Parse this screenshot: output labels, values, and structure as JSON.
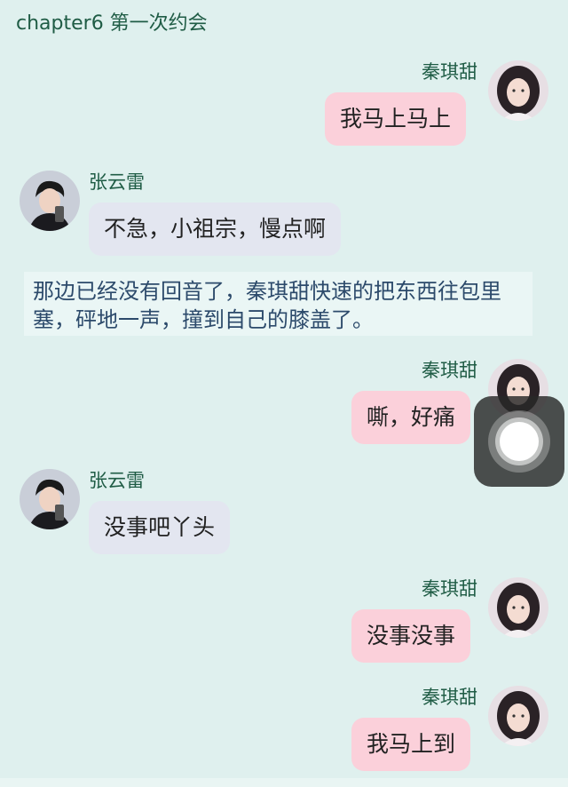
{
  "header": {
    "title": "chapter6 第一次约会"
  },
  "narration": "那边已经没有回音了，秦琪甜快速的把东西往包里塞，砰地一声，撞到自己的膝盖了。",
  "messages": [
    {
      "side": "right",
      "avatar": "female-avatar",
      "name": "秦琪甜",
      "text": "我马上马上"
    },
    {
      "side": "left",
      "avatar": "male-avatar",
      "name": "张云雷",
      "text": "不急，小祖宗，慢点啊"
    },
    {
      "side": "right",
      "avatar": "female-avatar",
      "name": "秦琪甜",
      "text": "嘶，好痛"
    },
    {
      "side": "left",
      "avatar": "male-avatar",
      "name": "张云雷",
      "text": "没事吧丫头"
    },
    {
      "side": "right",
      "avatar": "female-avatar",
      "name": "秦琪甜",
      "text": "没事没事"
    },
    {
      "side": "right",
      "avatar": "female-avatar",
      "name": "秦琪甜",
      "text": "我马上到"
    }
  ],
  "colors": {
    "background": "#dff0ee",
    "right_bubble": "#fbd0da",
    "left_bubble": "#e3e6f0",
    "name_text": "#1f5c45"
  },
  "overlay": {
    "icon": "assistive-touch-icon"
  }
}
